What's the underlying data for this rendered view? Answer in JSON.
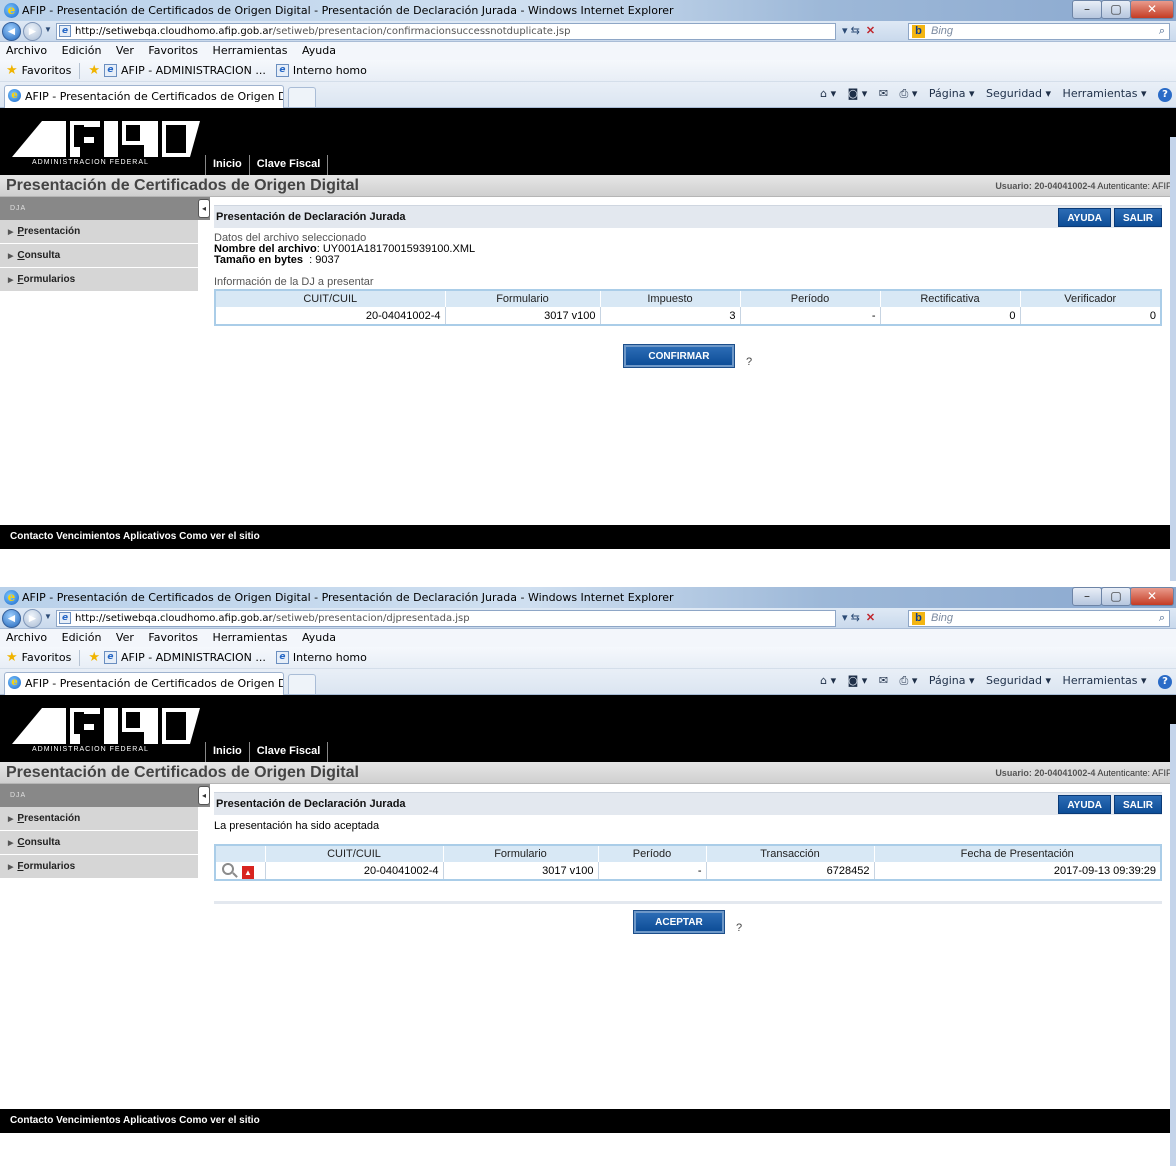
{
  "browser": {
    "window_title_1": "AFIP - Presentación de Certificados de Origen Digital - Presentación de Declaración Jurada - Windows Internet Explorer",
    "window_title_2": "AFIP - Presentación de Certificados de Origen Digital - Presentación de Declaración Jurada - Windows Internet Explorer",
    "url_host": "http://setiwebqa.cloudhomo.afip.gob.ar",
    "url_path_1": "/setiweb/presentacion/confirmacionsuccessnotduplicate.jsp",
    "url_path_2": "/setiweb/presentacion/djpresentada.jsp",
    "search_placeholder": "Bing",
    "menu": [
      "Archivo",
      "Edición",
      "Ver",
      "Favoritos",
      "Herramientas",
      "Ayuda"
    ],
    "favorites_label": "Favoritos",
    "fav_links": [
      "AFIP - ADMINISTRACION ...",
      "Interno homo"
    ],
    "tab_title": "AFIP - Presentación de Certificados de Origen Di...",
    "cmd": {
      "page": "Página ▾",
      "security": "Seguridad ▾",
      "tools": "Herramientas ▾"
    }
  },
  "site": {
    "logo_subtitle": "ADMINISTRACION FEDERAL",
    "nav": [
      "Inicio",
      "Clave Fiscal"
    ],
    "title": "Presentación de Certificados de Origen Digital",
    "user_label": "Usuario:",
    "user_value": "20-04041002-4",
    "auth_label": "Autenticante:",
    "auth_value": "AFIP",
    "sidebar_header": "DJA",
    "sidebar_items": [
      {
        "first": "P",
        "rest": "resentación"
      },
      {
        "first": "C",
        "rest": "onsulta"
      },
      {
        "first": "F",
        "rest": "ormularios"
      }
    ],
    "footer": "Contacto  Vencimientos  Aplicativos  Como ver el sitio",
    "help_button": "AYUDA",
    "exit_button": "SALIR"
  },
  "screen1": {
    "section_title": "Presentación de Declaración Jurada",
    "file_heading": "Datos del archivo seleccionado",
    "file_name_label": "Nombre del archivo",
    "file_name_value": ": UY001A18170015939100.XML",
    "file_size_label": "Tamaño en bytes",
    "file_size_value": "  : 9037",
    "dj_heading": "Información de la DJ a presentar",
    "columns": [
      "CUIT/CUIL",
      "Formulario",
      "Impuesto",
      "Período",
      "Rectificativa",
      "Verificador"
    ],
    "row": [
      "20-04041002-4",
      "3017 v100",
      "3",
      "-",
      "0",
      "0"
    ],
    "confirm_button": "CONFIRMAR",
    "help_mark": "?"
  },
  "screen2": {
    "section_title": "Presentación de Declaración Jurada",
    "message": "La presentación ha sido aceptada",
    "columns": [
      "CUIT/CUIL",
      "Formulario",
      "Período",
      "Transacción",
      "Fecha de Presentación"
    ],
    "row": [
      "20-04041002-4",
      "3017 v100",
      "-",
      "6728452",
      "2017-09-13 09:39:29"
    ],
    "accept_button": "ACEPTAR",
    "help_mark": "?"
  }
}
